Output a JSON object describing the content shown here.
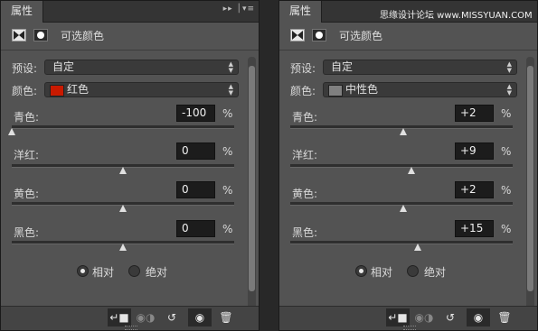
{
  "watermark": "思缘设计论坛 www.MISSYUAN.COM",
  "panels": [
    {
      "tab": "属性",
      "title": "可选颜色",
      "preset_label": "预设:",
      "preset_value": "自定",
      "colors_label": "颜色:",
      "colors_value": "红色",
      "swatch_color": "#c91a00",
      "sliders": [
        {
          "label": "青色:",
          "value": "-100",
          "unit": "%",
          "level": -1.0
        },
        {
          "label": "洋红:",
          "value": "0",
          "unit": "%",
          "level": 0.0
        },
        {
          "label": "黄色:",
          "value": "0",
          "unit": "%",
          "level": 0.0
        },
        {
          "label": "黑色:",
          "value": "0",
          "unit": "%",
          "level": 0.0
        }
      ],
      "method_options": [
        {
          "label": "相对",
          "selected": true
        },
        {
          "label": "绝对",
          "selected": false
        }
      ]
    },
    {
      "tab": "属性",
      "title": "可选颜色",
      "preset_label": "预设:",
      "preset_value": "自定",
      "colors_label": "颜色:",
      "colors_value": "中性色",
      "swatch_color": "#808080",
      "sliders": [
        {
          "label": "青色:",
          "value": "+2",
          "unit": "%",
          "level": 0.02
        },
        {
          "label": "洋红:",
          "value": "+9",
          "unit": "%",
          "level": 0.09
        },
        {
          "label": "黄色:",
          "value": "+2",
          "unit": "%",
          "level": 0.02
        },
        {
          "label": "黑色:",
          "value": "+15",
          "unit": "%",
          "level": 0.15
        }
      ],
      "method_options": [
        {
          "label": "相对",
          "selected": true
        },
        {
          "label": "绝对",
          "selected": false
        }
      ]
    }
  ],
  "icons": {
    "tab_controls": "collapse-menu-icon",
    "footer": [
      "clip-to-layer-icon",
      "view-previous-icon",
      "reset-icon",
      "visibility-icon",
      "delete-icon"
    ]
  }
}
